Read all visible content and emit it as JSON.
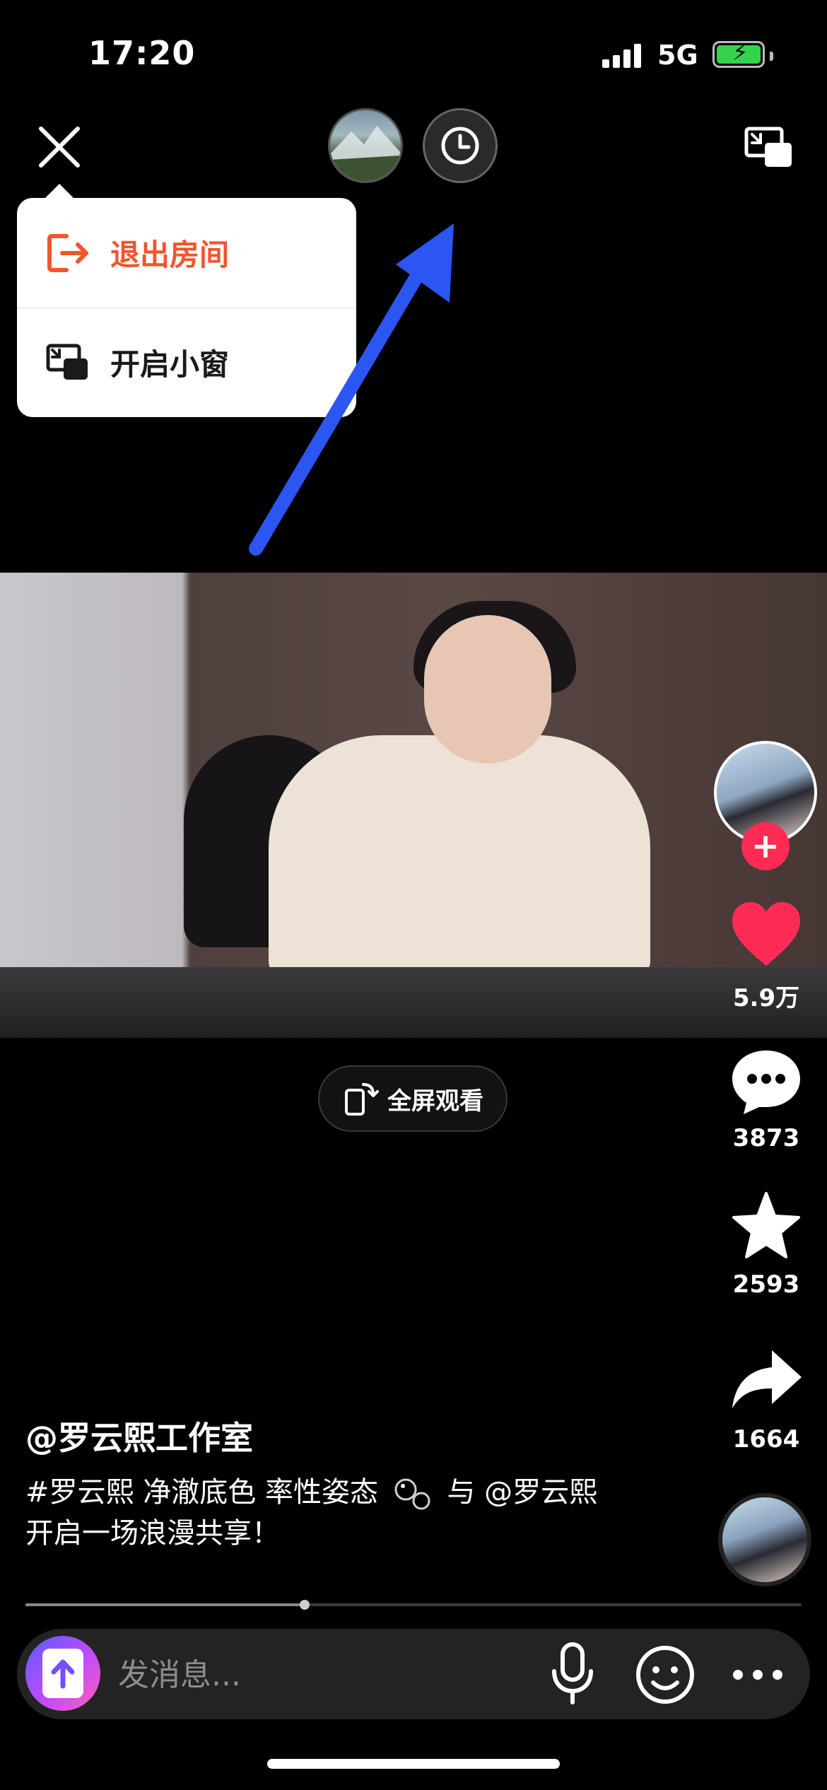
{
  "status_bar": {
    "time": "17:20",
    "network": "5G",
    "signal_bars": 4,
    "battery": "charging"
  },
  "top_bar": {
    "close_icon": "close-icon",
    "avatars": [
      "mountain-landscape-avatar",
      "history-clock-avatar"
    ],
    "pip_icon": "picture-in-picture-icon"
  },
  "menu": {
    "items": [
      {
        "label": "退出房间",
        "icon": "exit-room-icon",
        "color": "#f0552c"
      },
      {
        "label": "开启小窗",
        "icon": "mini-window-icon",
        "color": "#1a1a1a"
      }
    ]
  },
  "annotation": {
    "arrow_color": "#2b56f2"
  },
  "video": {
    "fullscreen_label": "全屏观看"
  },
  "right_rail": {
    "like_count": "5.9万",
    "comment_count": "3873",
    "favorite_count": "2593",
    "share_count": "1664",
    "like_color": "#fe2c55"
  },
  "caption": {
    "author": "@罗云熙工作室",
    "text_part1": "#罗云熙 净澈底色 率性姿态",
    "text_part2": "与 @罗云熙 开启一场浪漫共享！"
  },
  "progress": {
    "played_fraction": 0.36
  },
  "input_bar": {
    "placeholder": "发消息..."
  }
}
